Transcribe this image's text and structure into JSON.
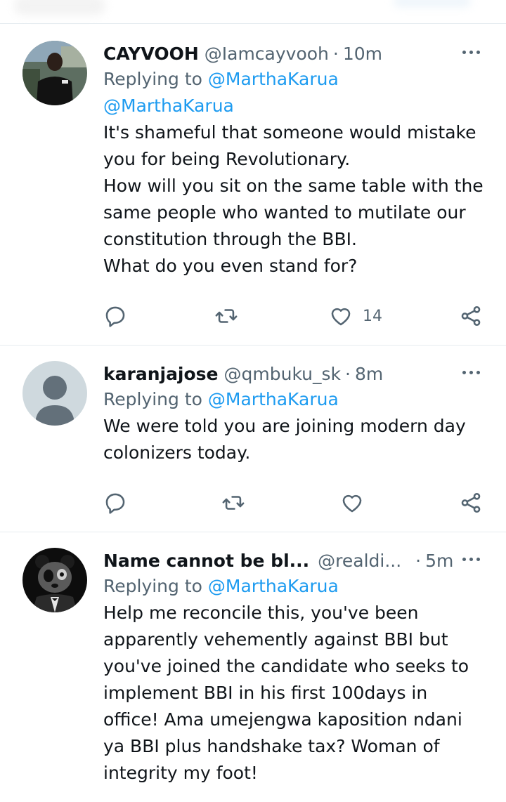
{
  "tweets": [
    {
      "name": "CAYVOOH",
      "handle": "@Iamcayvooh",
      "separator": "·",
      "time": "10m",
      "replying_prefix": "Replying to",
      "replying_to": "@MarthaKarua",
      "body_lines": [
        "@MarthaKarua",
        "It's shameful that someone would mistake",
        "you for being Revolutionary.",
        "How will you sit on the same table with the",
        "same people who wanted to mutilate our",
        "constitution through the BBI.",
        "What do you even stand for?"
      ],
      "like_count": "14",
      "avatar_icon": "photo-avatar-icon"
    },
    {
      "name": "karanjajose",
      "handle": "@qmbuku_sk",
      "separator": "·",
      "time": "8m",
      "replying_prefix": "Replying to",
      "replying_to": "@MarthaKarua",
      "body_lines": [
        "We were told you are joining modern day",
        "colonizers today."
      ],
      "like_count": "",
      "avatar_icon": "default-user-avatar-icon"
    },
    {
      "name": "Name cannot be bl...",
      "handle": "@realdi...",
      "separator": "·",
      "time": "5m",
      "replying_prefix": "Replying to",
      "replying_to": "@MarthaKarua",
      "body_lines": [
        "Help me reconcile this, you've been",
        "apparently vehemently against BBI but",
        "you've joined the candidate who seeks to",
        "implement BBI in his first 100days in",
        "office! Ama umejengwa kaposition ndani",
        "ya BBI plus handshake tax? Woman of",
        "integrity my foot!"
      ],
      "like_count": "",
      "avatar_icon": "panda-avatar-icon"
    }
  ],
  "icons": {
    "reply": "reply-icon",
    "retweet": "retweet-icon",
    "like": "heart-icon",
    "share": "share-icon",
    "more": "more-options-icon"
  },
  "colors": {
    "link": "#1d9bf0",
    "secondary_text": "#536471",
    "primary_text": "#0f1419",
    "divider": "#e6ecf0"
  }
}
